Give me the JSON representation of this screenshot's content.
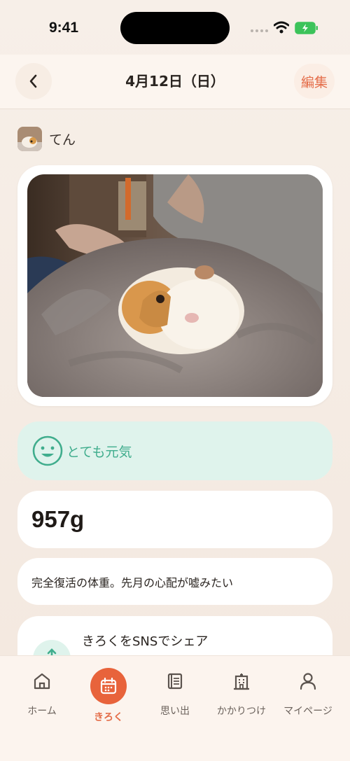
{
  "status_bar": {
    "time": "9:41"
  },
  "header": {
    "title": "4月12日（日）",
    "edit_label": "編集",
    "back_icon": "chevron-left-icon"
  },
  "pet": {
    "name": "てん"
  },
  "mood": {
    "label": "とても元気",
    "icon": "smile-icon",
    "color": "#40ad8d"
  },
  "weight": {
    "value": "957g"
  },
  "memo": {
    "text": "完全復活の体重。先月の心配が嘘みたい"
  },
  "share": {
    "title": "きろくをSNSでシェア"
  },
  "tabs": [
    {
      "label": "ホーム",
      "icon": "home-icon",
      "active": false
    },
    {
      "label": "きろく",
      "icon": "calendar-icon",
      "active": true
    },
    {
      "label": "思い出",
      "icon": "album-icon",
      "active": false
    },
    {
      "label": "かかりつけ",
      "icon": "hospital-icon",
      "active": false
    },
    {
      "label": "マイページ",
      "icon": "person-icon",
      "active": false
    }
  ],
  "colors": {
    "accent": "#e8633b",
    "mood_bg": "#dff3ec",
    "background": "#f7efe8"
  }
}
